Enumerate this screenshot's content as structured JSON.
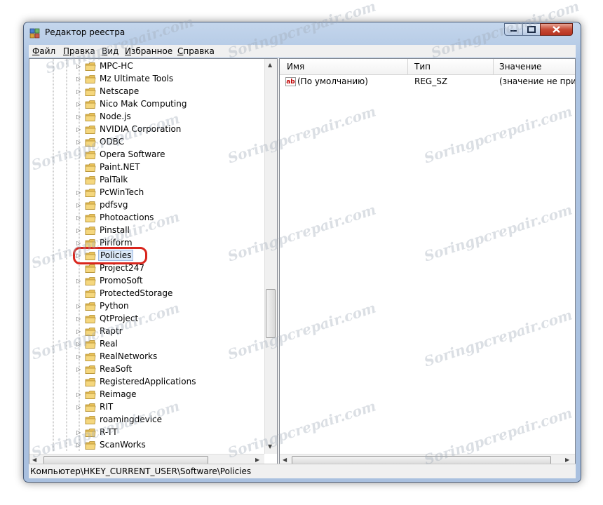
{
  "window": {
    "title": "Редактор реестра"
  },
  "menu": [
    {
      "accel": "Ф",
      "rest": "айл"
    },
    {
      "accel": "П",
      "rest": "равка"
    },
    {
      "accel": "В",
      "rest": "ид"
    },
    {
      "accel": "И",
      "rest": "збранное"
    },
    {
      "accel": "С",
      "rest": "правка"
    }
  ],
  "tree": {
    "items": [
      {
        "label": "MPC-HC",
        "expandable": true
      },
      {
        "label": "Mz Ultimate Tools",
        "expandable": true
      },
      {
        "label": "Netscape",
        "expandable": true
      },
      {
        "label": "Nico Mak Computing",
        "expandable": true
      },
      {
        "label": "Node.js",
        "expandable": true
      },
      {
        "label": "NVIDIA Corporation",
        "expandable": true
      },
      {
        "label": "ODBC",
        "expandable": true
      },
      {
        "label": "Opera Software",
        "expandable": false
      },
      {
        "label": "Paint.NET",
        "expandable": false
      },
      {
        "label": "PalTalk",
        "expandable": false
      },
      {
        "label": "PcWinTech",
        "expandable": true
      },
      {
        "label": "pdfsvg",
        "expandable": true
      },
      {
        "label": "Photoactions",
        "expandable": true
      },
      {
        "label": "Pinstall",
        "expandable": true
      },
      {
        "label": "Piriform",
        "expandable": true
      },
      {
        "label": "Policies",
        "expandable": true,
        "selected": true
      },
      {
        "label": "Project247",
        "expandable": false
      },
      {
        "label": "PromoSoft",
        "expandable": true
      },
      {
        "label": "ProtectedStorage",
        "expandable": false
      },
      {
        "label": "Python",
        "expandable": true
      },
      {
        "label": "QtProject",
        "expandable": true
      },
      {
        "label": "Raptr",
        "expandable": true
      },
      {
        "label": "Real",
        "expandable": true
      },
      {
        "label": "RealNetworks",
        "expandable": true
      },
      {
        "label": "ReaSoft",
        "expandable": true
      },
      {
        "label": "RegisteredApplications",
        "expandable": false
      },
      {
        "label": "Reimage",
        "expandable": true
      },
      {
        "label": "RIT",
        "expandable": true
      },
      {
        "label": "roamingdevice",
        "expandable": false
      },
      {
        "label": "R-TT",
        "expandable": true
      },
      {
        "label": "ScanWorks",
        "expandable": true
      }
    ]
  },
  "list": {
    "columns": [
      "Имя",
      "Тип",
      "Значение"
    ],
    "rows": [
      {
        "name": "(По умолчанию)",
        "type": "REG_SZ",
        "value": "(значение не присво"
      }
    ]
  },
  "status": {
    "path": "Компьютер\\HKEY_CURRENT_USER\\Software\\Policies"
  },
  "watermark": "Soringpcrepair.com",
  "colors": {
    "highlight": "#d9251d",
    "folder": "#e8c15a"
  }
}
